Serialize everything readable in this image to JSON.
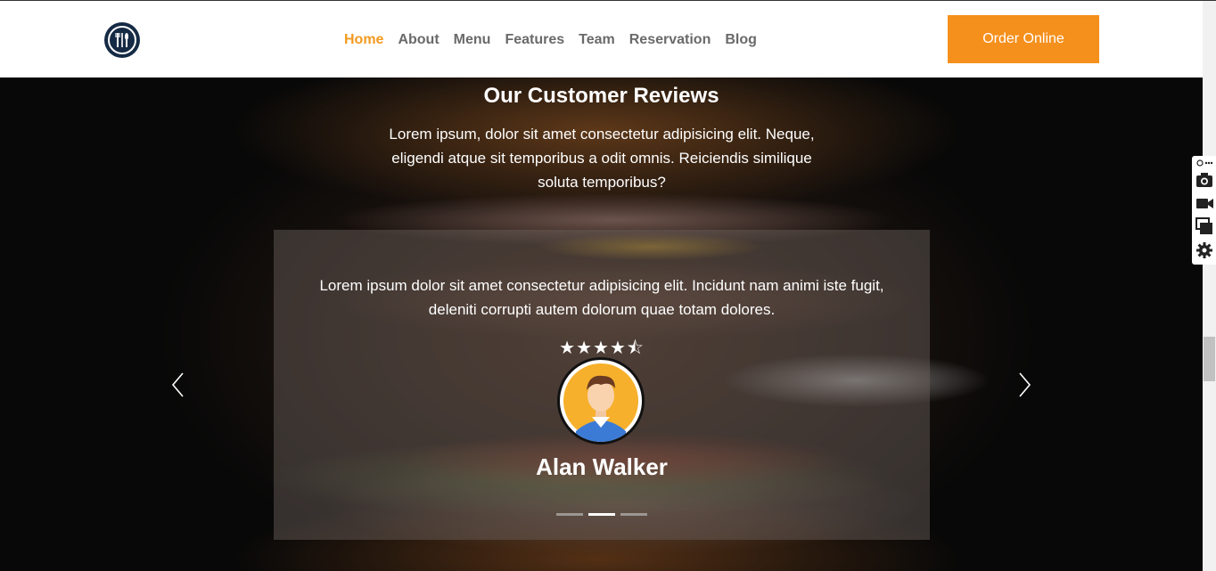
{
  "nav": {
    "items": [
      {
        "label": "Home",
        "active": true
      },
      {
        "label": "About",
        "active": false
      },
      {
        "label": "Menu",
        "active": false
      },
      {
        "label": "Features",
        "active": false
      },
      {
        "label": "Team",
        "active": false
      },
      {
        "label": "Reservation",
        "active": false
      },
      {
        "label": "Blog",
        "active": false
      }
    ],
    "order_button": "Order Online",
    "logo_icon": "utensils-icon"
  },
  "reviews": {
    "title": "Our Customer Reviews",
    "description": "Lorem ipsum, dolor sit amet consectetur adipisicing elit. Neque, eligendi atque sit temporibus a odit omnis. Reiciendis similique soluta temporibus?",
    "current": {
      "text": "Lorem ipsum dolor sit amet consectetur adipisicing elit. Incidunt nam animi iste fugit, deleniti corrupti autem dolorum quae totam dolores.",
      "rating": 4.5,
      "stars": "★★★★⯪",
      "name": "Alan Walker"
    },
    "slide_count": 3,
    "active_slide": 2
  },
  "colors": {
    "accent": "#f5901c",
    "nav_active": "#f39a1f",
    "nav_text": "#6a6a6a",
    "logo": "#152a44"
  }
}
